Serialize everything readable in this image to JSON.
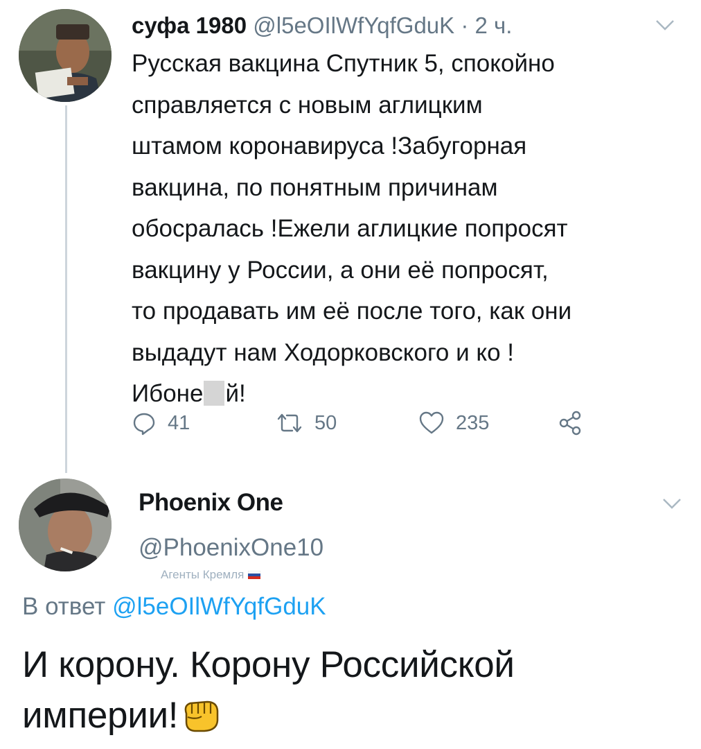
{
  "tweet1": {
    "display_name": "суфа 1980",
    "handle": "@l5eOIlWfYqfGduK",
    "separator": "·",
    "time": "2 ч.",
    "lines": [
      "Русская вакцина Спутник 5, спокойно",
      "справляется с новым аглицким",
      "штамом коронавируса !Забугорная",
      "вакцина, по понятным причинам",
      "обосралась !Ежели аглицкие попросят",
      "вакцину у России, а они её попросят,",
      "то продавать им её после того, как они",
      "выдадут нам Ходорковского и ко !"
    ],
    "last_line_start": "Ибоне",
    "last_line_end": "й!",
    "actions": {
      "reply_count": "41",
      "retweet_count": "50",
      "like_count": "235"
    }
  },
  "tweet2": {
    "display_name": "Phoenix One",
    "handle": "@PhoenixOne10",
    "badge_text": "Агенты Кремля",
    "reply_prefix": "В ответ",
    "reply_handle": "@l5eOIlWfYqfGduK",
    "body_line1": "И корону. Корону Российской",
    "body_line2": "империи!"
  },
  "colors": {
    "text": "#14171a",
    "secondary": "#657786",
    "link": "#1da1f2",
    "thread_line": "#cdd5dc"
  },
  "icons": [
    "reply-icon",
    "retweet-icon",
    "like-icon",
    "share-icon",
    "chevron-down-icon",
    "russian-flag-icon",
    "raised-fist-emoji"
  ]
}
